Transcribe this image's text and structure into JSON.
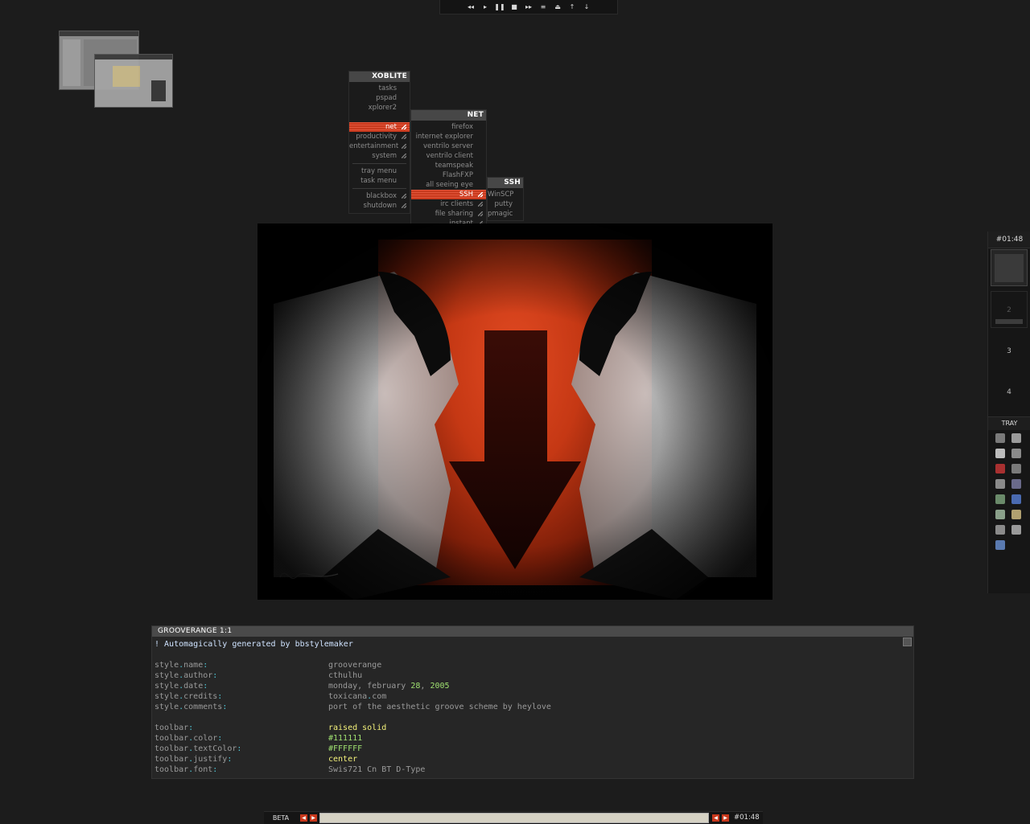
{
  "media_controls": {
    "buttons": [
      "previous",
      "play",
      "pause",
      "stop",
      "next",
      "playlist",
      "eject",
      "volume-up",
      "volume-down"
    ],
    "glyphs": [
      "◂◂",
      "▸",
      "❚❚",
      "■",
      "▸▸",
      "≡",
      "⏏",
      "↑",
      "↓"
    ]
  },
  "root_menu": {
    "title": "XOBLITE",
    "items": [
      "tasks",
      "pspad",
      "xplorer2",
      "",
      "net",
      "productivity",
      "entertainment",
      "system",
      "tray menu",
      "task menu",
      "blackbox",
      "shutdown"
    ]
  },
  "net_menu": {
    "title": "NET",
    "items": [
      "firefox",
      "internet explorer",
      "ventrilo server",
      "ventrilo client",
      "teamspeak",
      "FlashFXP",
      "all seeing eye",
      "SSH",
      "irc clients",
      "file sharing",
      "instant messaging"
    ]
  },
  "ssh_menu": {
    "title": "SSH",
    "items": [
      "WinSCP",
      "putty",
      "pmagic"
    ]
  },
  "dock": {
    "clock": "#01:48",
    "workspaces": [
      "",
      "2",
      "3",
      "4"
    ],
    "tray_label": "TRAY",
    "tray_icon_count": 15
  },
  "editor": {
    "title": "GROOVERANGE 1:1",
    "header_comment": "! Automagically generated by bbstylemaker",
    "style_lines": [
      {
        "key": "style.name",
        "value": "grooverange"
      },
      {
        "key": "style.author",
        "value": "cthulhu"
      },
      {
        "key": "style.date",
        "value": "monday, february 28, 2005"
      },
      {
        "key": "style.credits",
        "value": "toxicana.com"
      },
      {
        "key": "style.comments",
        "value": "port of the aesthetic groove scheme by heylove"
      }
    ],
    "toolbar_lines": [
      {
        "key": "toolbar",
        "value": "raised solid"
      },
      {
        "key": "toolbar.color",
        "value": "#111111"
      },
      {
        "key": "toolbar.textColor",
        "value": "#FFFFFF"
      },
      {
        "key": "toolbar.justify",
        "value": "center"
      },
      {
        "key": "toolbar.font",
        "value": "Swis721 Cn BT D-Type"
      }
    ]
  },
  "toolbar": {
    "workspace_name": "BETA",
    "clock": "#01:48"
  },
  "colors": {
    "accent": "#c93a1e",
    "desktop_bg": "#1c1c1c",
    "value_green": "#9fe070",
    "value_yellow": "#f2f07a",
    "colon_cyan": "#4fc8d8"
  }
}
